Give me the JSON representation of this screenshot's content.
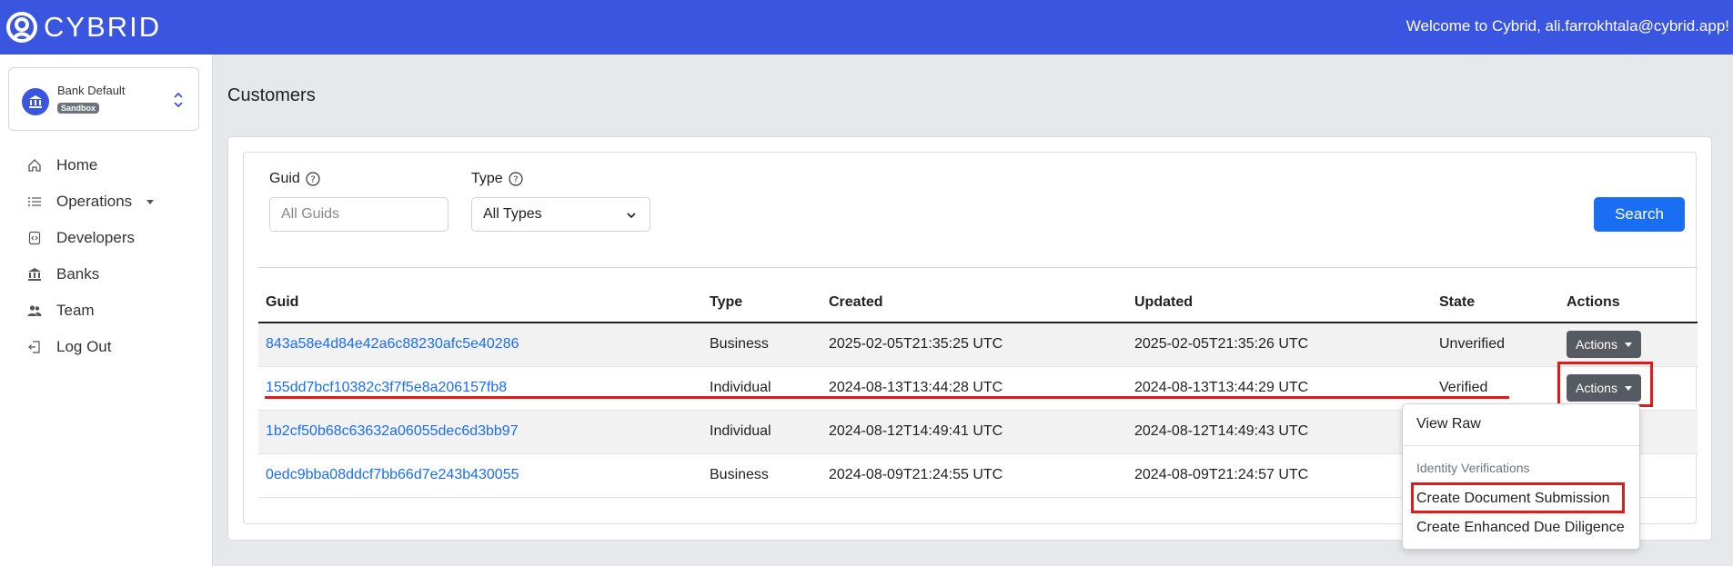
{
  "brand": {
    "name": "CYBRID",
    "welcome": "Welcome to Cybrid, ali.farrokhtala@cybrid.app!"
  },
  "bank": {
    "name": "Bank Default",
    "badge": "Sandbox"
  },
  "nav": [
    {
      "label": "Home",
      "icon": "home-icon"
    },
    {
      "label": "Operations",
      "icon": "list-icon"
    },
    {
      "label": "Developers",
      "icon": "code-icon"
    },
    {
      "label": "Banks",
      "icon": "bank-icon"
    },
    {
      "label": "Team",
      "icon": "users-icon"
    },
    {
      "label": "Log Out",
      "icon": "logout-icon"
    }
  ],
  "page": {
    "title": "Customers"
  },
  "filters": {
    "guid_label": "Guid",
    "guid_placeholder": "All Guids",
    "type_label": "Type",
    "type_value": "All Types",
    "search_label": "Search"
  },
  "table": {
    "headers": [
      "Guid",
      "Type",
      "Created",
      "Updated",
      "State",
      "Actions"
    ],
    "rows": [
      {
        "guid": "843a58e4d84e42a6c88230afc5e40286",
        "type": "Business",
        "created": "2025-02-05T21:35:25 UTC",
        "updated": "2025-02-05T21:35:26 UTC",
        "state": "Unverified",
        "action": "Actions"
      },
      {
        "guid": "155dd7bcf10382c3f7f5e8a206157fb8",
        "type": "Individual",
        "created": "2024-08-13T13:44:28 UTC",
        "updated": "2024-08-13T13:44:29 UTC",
        "state": "Verified",
        "action": "Actions"
      },
      {
        "guid": "1b2cf50b68c63632a06055dec6d3bb97",
        "type": "Individual",
        "created": "2024-08-12T14:49:41 UTC",
        "updated": "2024-08-12T14:49:43 UTC",
        "state": "",
        "action": ""
      },
      {
        "guid": "0edc9bba08ddcf7bb66d7e243b430055",
        "type": "Business",
        "created": "2024-08-09T21:24:55 UTC",
        "updated": "2024-08-09T21:24:57 UTC",
        "state": "",
        "action": ""
      }
    ]
  },
  "dropdown": {
    "view_raw": "View Raw",
    "section": "Identity Verifications",
    "create_doc": "Create Document Submission",
    "create_edd": "Create Enhanced Due Diligence"
  },
  "colors": {
    "brand": "#3a55e0",
    "primary": "#1a6ef2",
    "annotation": "#e11b1b"
  }
}
